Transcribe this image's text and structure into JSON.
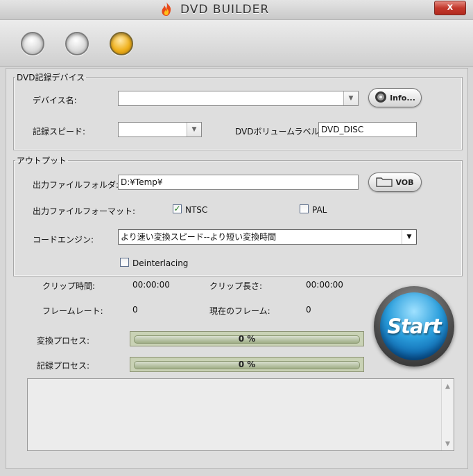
{
  "window": {
    "title": "DVD BUILDER",
    "close_label": "x"
  },
  "toolbar": {
    "buttons": [
      {
        "name": "step-1",
        "state": "inactive"
      },
      {
        "name": "step-2",
        "state": "inactive"
      },
      {
        "name": "step-3",
        "state": "active"
      }
    ]
  },
  "dvd_device": {
    "legend": "DVD記録デバイス",
    "device_name_label": "デバイス名:",
    "device_name_value": "",
    "info_button": "Info...",
    "record_speed_label": "記録スピード:",
    "record_speed_value": "",
    "volume_label_label": "DVDボリュームラベル:",
    "volume_label_value": "DVD_DISC"
  },
  "output": {
    "legend": "アウトプット",
    "folder_label": "出力ファイルフォルダ:",
    "folder_value": "D:¥Temp¥",
    "vob_button": "VOB",
    "format_label": "出力ファイルフォーマット:",
    "ntsc_label": "NTSC",
    "ntsc_checked": true,
    "pal_label": "PAL",
    "pal_checked": false,
    "code_engine_label": "コードエンジン:",
    "code_engine_value": "より速い変換スピード--より短い変換時間",
    "deinterlacing_label": "Deinterlacing",
    "deinterlacing_checked": false
  },
  "stats": {
    "clip_time_label": "クリップ時間:",
    "clip_time_value": "00:00:00",
    "clip_length_label": "クリップ長さ:",
    "clip_length_value": "00:00:00",
    "frame_rate_label": "フレームレート:",
    "frame_rate_value": "0",
    "current_frame_label": "現在のフレーム:",
    "current_frame_value": "0"
  },
  "progress": {
    "convert_label": "変換プロセス:",
    "convert_value": 0,
    "convert_text": "0 %",
    "record_label": "記録プロセス:",
    "record_value": 0,
    "record_text": "0 %"
  },
  "start_button": "Start",
  "colors": {
    "accent_orange": "#f0b21f",
    "start_blue": "#2a9edc",
    "progress_green": "#4b8f2b",
    "close_red": "#c3392d"
  }
}
